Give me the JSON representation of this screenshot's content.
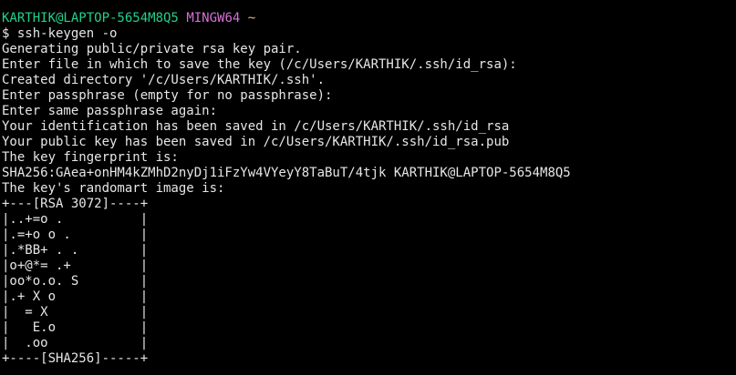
{
  "prompt": {
    "user_host": "KARTHIK@LAPTOP-5654M8Q5",
    "system": "MINGW64",
    "path": "~"
  },
  "command": "$ ssh-keygen -o",
  "output_lines": [
    "Generating public/private rsa key pair.",
    "Enter file in which to save the key (/c/Users/KARTHIK/.ssh/id_rsa):",
    "Created directory '/c/Users/KARTHIK/.ssh'.",
    "Enter passphrase (empty for no passphrase):",
    "Enter same passphrase again:",
    "Your identification has been saved in /c/Users/KARTHIK/.ssh/id_rsa",
    "Your public key has been saved in /c/Users/KARTHIK/.ssh/id_rsa.pub",
    "The key fingerprint is:",
    "SHA256:GAea+onHM4kZMhD2nyDj1iFzYw4VYeyY8TaBuT/4tjk KARTHIK@LAPTOP-5654M8Q5",
    "The key's randomart image is:",
    "+---[RSA 3072]----+",
    "|..+=o .          |",
    "|.=+o o .         |",
    "|.*BB+ . .        |",
    "|o+@*= .+         |",
    "|oo*o.o. S        |",
    "|.+ X o           |",
    "|  = X            |",
    "|   E.o           |",
    "|  .oo            |",
    "+----[SHA256]-----+"
  ],
  "colors": {
    "background": "#000000",
    "text": "#e6e6e6",
    "user_host": "#23d18b",
    "system": "#d670d6",
    "path": "#d7ba7d"
  }
}
